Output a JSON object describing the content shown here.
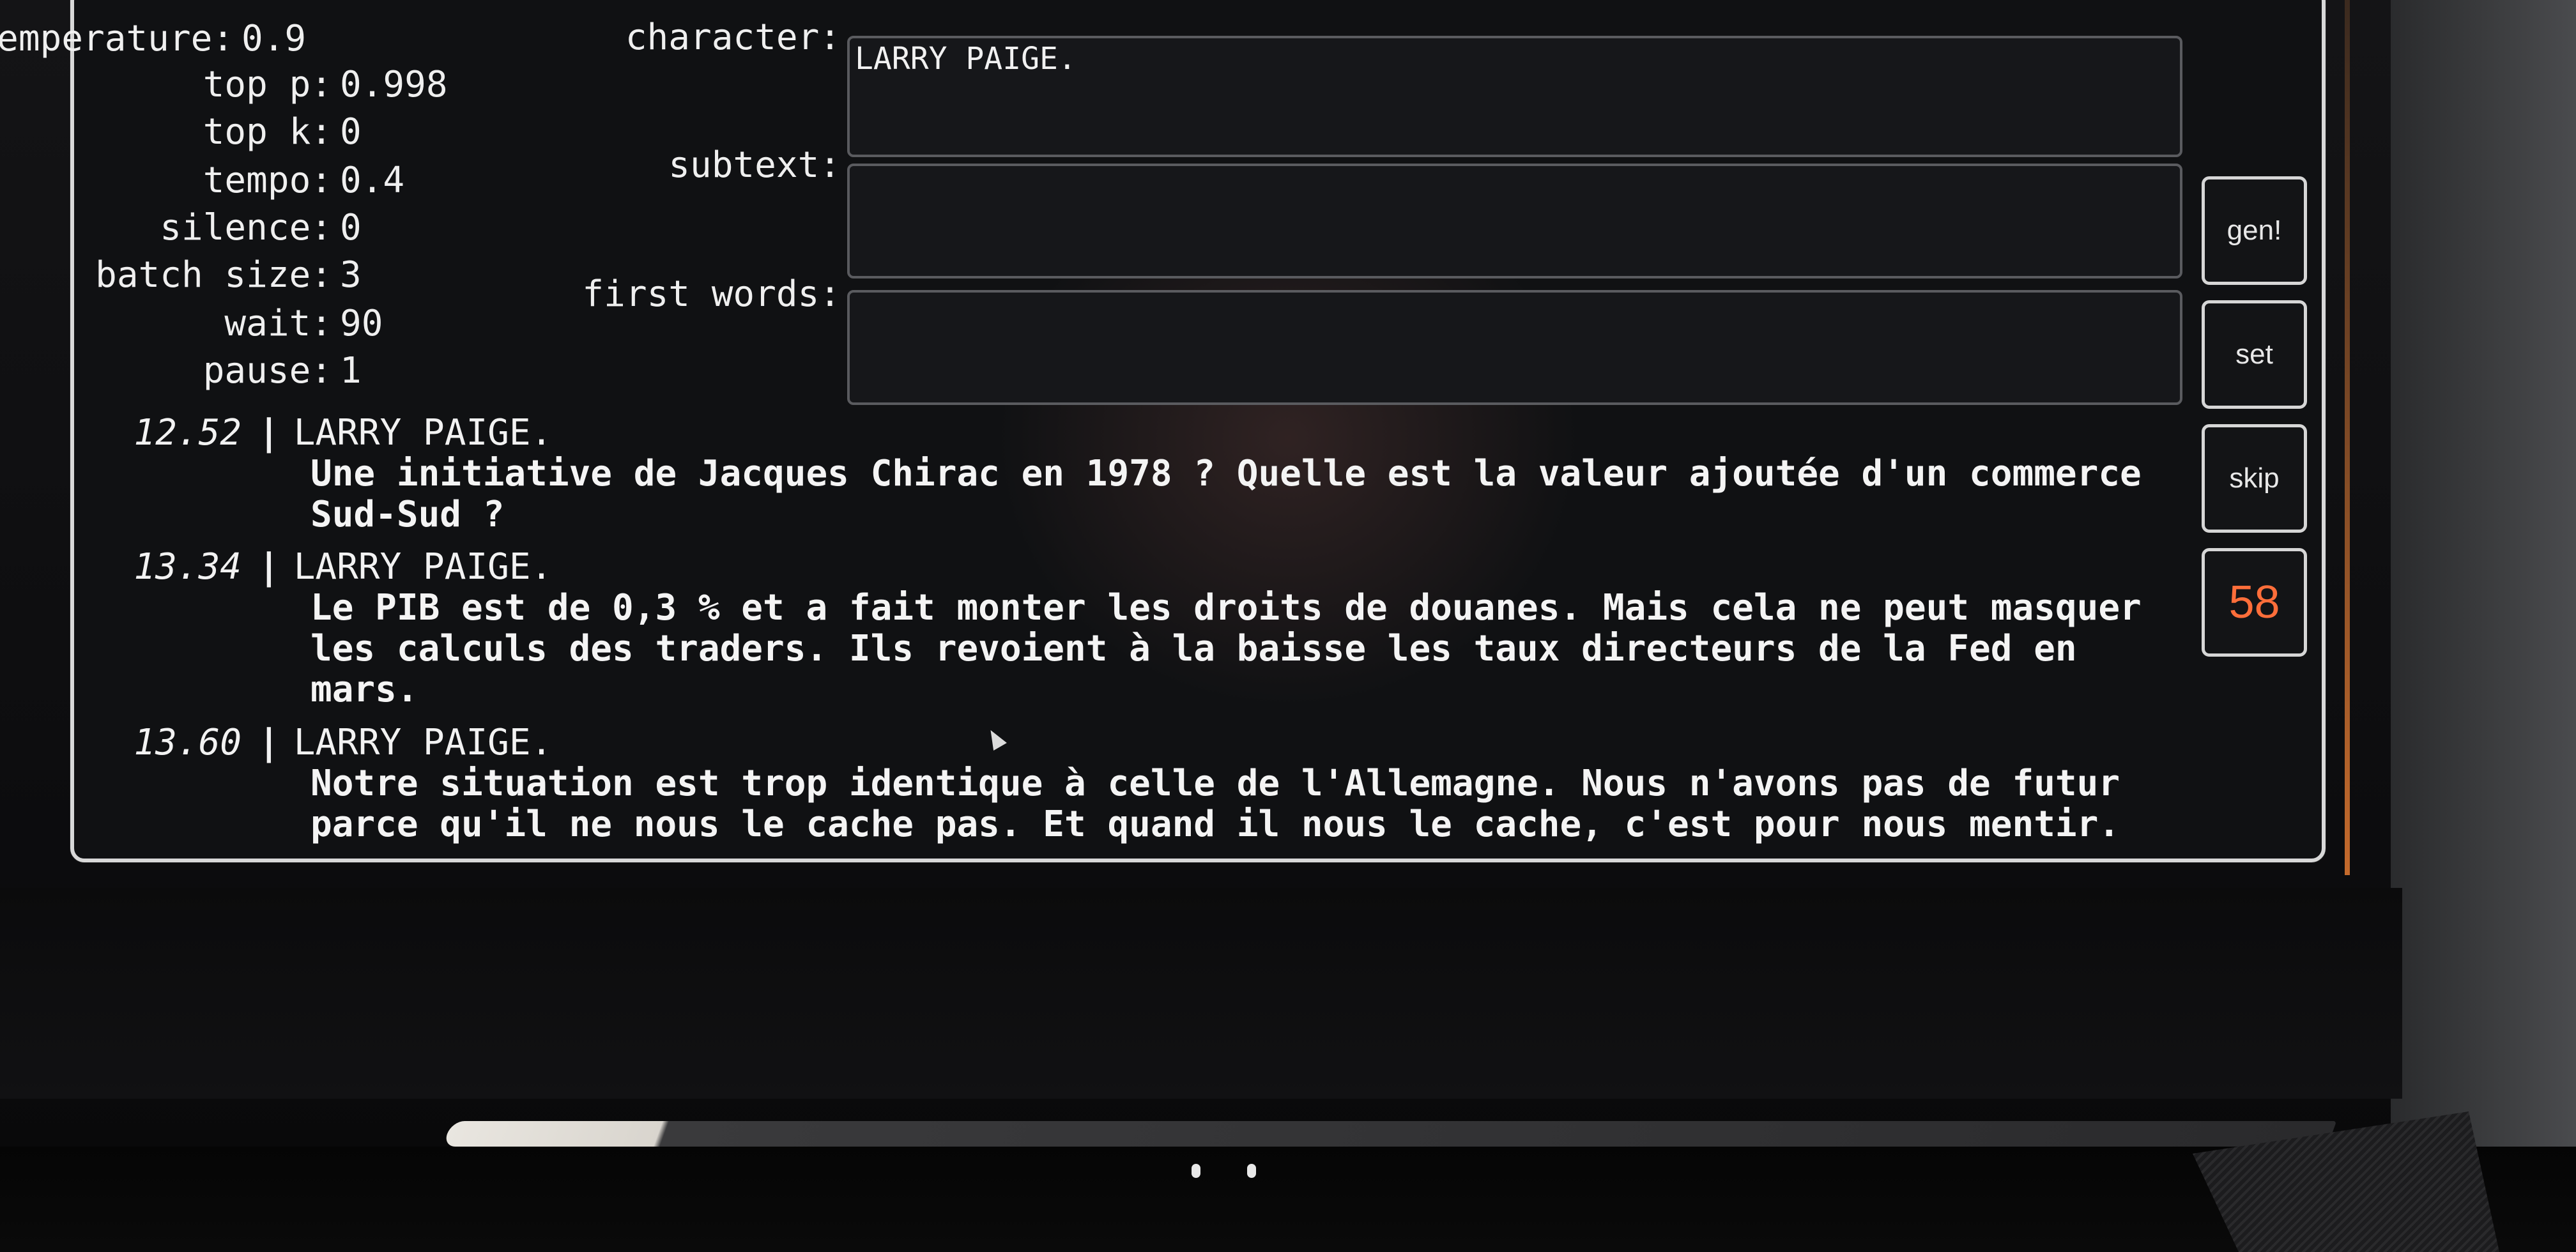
{
  "params": [
    {
      "key": "temperature:",
      "value": "0.9"
    },
    {
      "key": "top p:",
      "value": "0.998"
    },
    {
      "key": "top k:",
      "value": "0"
    },
    {
      "key": "tempo:",
      "value": "0.4"
    },
    {
      "key": "silence:",
      "value": "0"
    },
    {
      "key": "batch size:",
      "value": "3"
    },
    {
      "key": "wait:",
      "value": "90"
    },
    {
      "key": "pause:",
      "value": "1"
    }
  ],
  "fields": {
    "character": {
      "label": "character:",
      "value": "LARRY PAIGE."
    },
    "subtext": {
      "label": "subtext:",
      "value": ""
    },
    "first_words": {
      "label": "first words:",
      "value": ""
    }
  },
  "buttons": {
    "gen": "gen!",
    "set": "set",
    "skip": "skip",
    "count": "58"
  },
  "log": [
    {
      "time": "12.52",
      "sep": "|",
      "character": "LARRY PAIGE.",
      "text": "Une initiative de Jacques Chirac en 1978 ? Quelle est la valeur ajoutée d'un commerce\nSud-Sud ?"
    },
    {
      "time": "13.34",
      "sep": "|",
      "character": "LARRY PAIGE.",
      "text": "Le PIB est de 0,3 % et a fait monter les droits de douanes. Mais cela ne peut masquer\nles calculs des traders. Ils revoient à la baisse les taux directeurs de la Fed en\nmars."
    },
    {
      "time": "13.60",
      "sep": "|",
      "character": "LARRY PAIGE.",
      "text": "Notre situation est trop identique à celle de l'Allemagne. Nous n'avons pas de futur\nparce qu'il ne nous le cache pas. Et quand il nous le cache, c'est pour nous mentir."
    }
  ]
}
